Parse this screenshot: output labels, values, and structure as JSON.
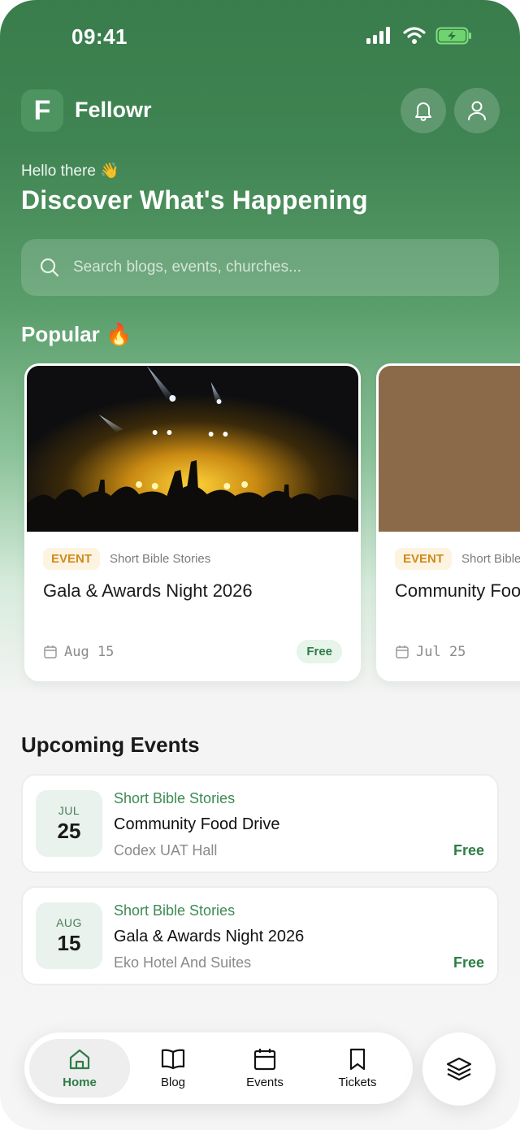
{
  "status_bar": {
    "time": "09:41"
  },
  "app": {
    "logo_letter": "F",
    "name": "Fellowr"
  },
  "greeting": "Hello there 👋",
  "headline": "Discover What's Happening",
  "search": {
    "placeholder": "Search blogs, events, churches..."
  },
  "sections": {
    "popular": "Popular 🔥",
    "upcoming": "Upcoming Events"
  },
  "popular_cards": [
    {
      "tag": "EVENT",
      "category": "Short Bible Stories",
      "title": "Gala & Awards Night 2026",
      "date": "Aug 15",
      "price": "Free"
    },
    {
      "tag": "EVENT",
      "category": "Short Bible Stories",
      "title": "Community Food Drive",
      "date": "Jul 25",
      "price": ""
    }
  ],
  "upcoming_events": [
    {
      "month": "JUL",
      "day": "25",
      "category": "Short Bible Stories",
      "title": "Community Food Drive",
      "venue": "Codex UAT Hall",
      "price": "Free"
    },
    {
      "month": "AUG",
      "day": "15",
      "category": "Short Bible Stories",
      "title": "Gala & Awards Night 2026",
      "venue": "Eko Hotel And Suites",
      "price": "Free"
    }
  ],
  "nav": [
    {
      "label": "Home",
      "icon": "home-icon",
      "active": true
    },
    {
      "label": "Blog",
      "icon": "book-icon",
      "active": false
    },
    {
      "label": "Events",
      "icon": "calendar-icon",
      "active": false
    },
    {
      "label": "Tickets",
      "icon": "bookmark-icon",
      "active": false
    }
  ],
  "colors": {
    "brand_green": "#3a7d4c",
    "accent_green": "#2e7d46",
    "event_tag": "#d08a1d",
    "card2_image": "#8b6a4a"
  }
}
